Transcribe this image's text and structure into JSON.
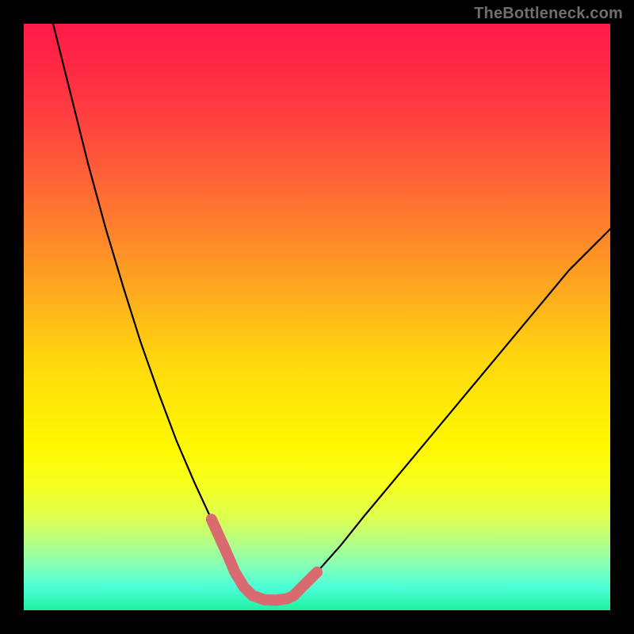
{
  "watermark": "TheBottleneck.com",
  "colors": {
    "background": "#000000",
    "curve": "#000000",
    "highlight": "#d96a6f",
    "gradient_top": "#ff1a49",
    "gradient_bottom": "#20f0a0"
  },
  "chart_data": {
    "type": "line",
    "title": "",
    "xlabel": "",
    "ylabel": "",
    "xlim": [
      0,
      100
    ],
    "ylim": [
      0,
      100
    ],
    "series": [
      {
        "name": "left-curve",
        "x": [
          5,
          8,
          11,
          14,
          17,
          20,
          23,
          26,
          29,
          32,
          34.5,
          36,
          37.5,
          39,
          40
        ],
        "y": [
          100,
          88,
          76,
          65,
          55,
          45.5,
          37,
          29,
          22,
          15.5,
          10,
          6.5,
          4,
          2.5,
          2
        ]
      },
      {
        "name": "valley-floor",
        "x": [
          40,
          41,
          42,
          43,
          44,
          45
        ],
        "y": [
          2,
          1.8,
          1.7,
          1.7,
          1.8,
          2
        ]
      },
      {
        "name": "right-curve",
        "x": [
          45,
          47,
          50,
          54,
          58,
          63,
          68,
          73,
          78,
          83,
          88,
          93,
          98,
          100
        ],
        "y": [
          2,
          3.5,
          6.5,
          11,
          16,
          22,
          28,
          34,
          40,
          46,
          52,
          58,
          63,
          65
        ]
      }
    ],
    "highlight_segments": [
      {
        "name": "left-highlight",
        "x": [
          32,
          34.5,
          36,
          37.5,
          39
        ],
        "y": [
          15.5,
          10,
          6.5,
          4,
          2.5
        ]
      },
      {
        "name": "bottom-highlight",
        "x": [
          39,
          41,
          43,
          45,
          46
        ],
        "y": [
          2.5,
          1.8,
          1.7,
          2,
          2.5
        ]
      },
      {
        "name": "right-highlight",
        "x": [
          46,
          47,
          48.5,
          50
        ],
        "y": [
          2.5,
          3.5,
          5,
          6.5
        ]
      }
    ]
  }
}
